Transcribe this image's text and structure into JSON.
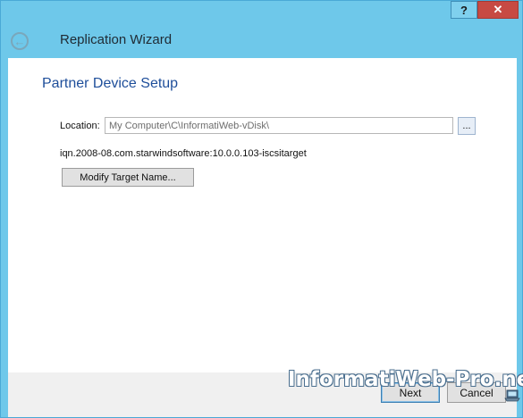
{
  "window": {
    "help_label": "?",
    "close_label": "✕"
  },
  "header": {
    "back_icon": "back-arrow-icon",
    "title": "Replication Wizard"
  },
  "page": {
    "title": "Partner Device Setup",
    "location_label": "Location:",
    "location_value": "My Computer\\C\\InformatiWeb-vDisk\\",
    "browse_label": "...",
    "iqn_text": "iqn.2008-08.com.starwindsoftware:10.0.0.103-iscsitarget",
    "modify_label": "Modify Target Name..."
  },
  "footer": {
    "next_label": "Next",
    "cancel_label": "Cancel"
  },
  "watermark": {
    "text": "InformatiWeb-Pro.net",
    "icon": "laptop-icon"
  },
  "colors": {
    "title_bar": "#6ec8ea",
    "page_title": "#1e4e9a",
    "close_button": "#c74a43"
  }
}
